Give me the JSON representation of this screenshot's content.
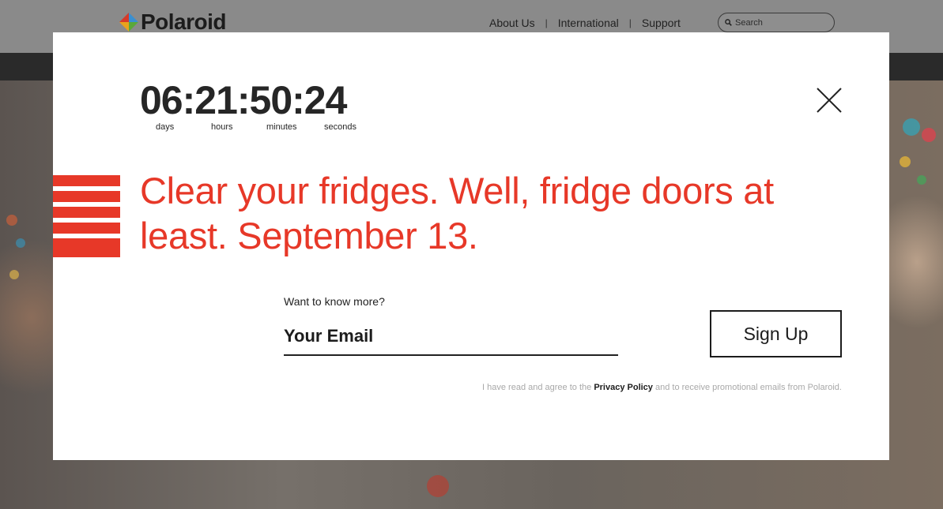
{
  "site": {
    "brand": "Polaroid",
    "nav": [
      {
        "label": "About Us"
      },
      {
        "label": "International"
      },
      {
        "label": "Support"
      }
    ],
    "nav_separator": "|",
    "search": {
      "placeholder": "Search",
      "icon": "search-icon"
    }
  },
  "modal": {
    "countdown": {
      "display": "06:21:50:24",
      "units": {
        "days": {
          "value": "06",
          "label": "days"
        },
        "hours": {
          "value": "21",
          "label": "hours"
        },
        "minutes": {
          "value": "50",
          "label": "minutes"
        },
        "seconds": {
          "value": "24",
          "label": "seconds"
        }
      }
    },
    "close_icon": "close-icon",
    "headline": "Clear your fridges. Well, fridge doors at least. September 13.",
    "form": {
      "prompt": "Want to know more?",
      "email_placeholder": "Your Email",
      "submit_label": "Sign Up"
    },
    "legal": {
      "prefix": "I have read and agree to the",
      "link": "Privacy Policy",
      "suffix": "and to receive promotional emails from Polaroid."
    }
  },
  "colors": {
    "accent": "#e73828",
    "text": "#262626",
    "overlay": "#6e6e6e",
    "modal_bg": "#ffffff"
  }
}
